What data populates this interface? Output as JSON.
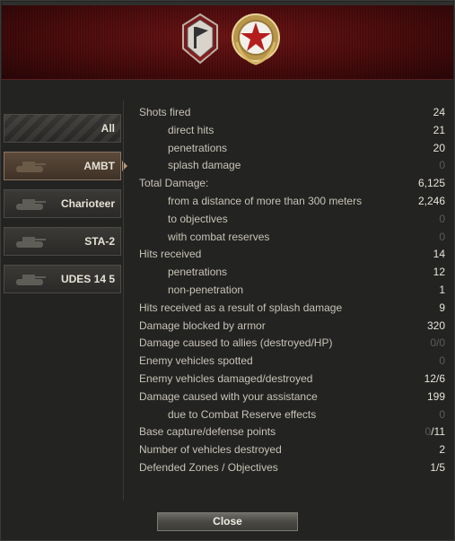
{
  "header": {
    "badges": [
      "shield-flag-badge-icon",
      "star-wreath-badge-icon"
    ],
    "accent_color": "#5a0f10"
  },
  "sidebar": {
    "items": [
      {
        "label": "All",
        "icon": "camo-pattern",
        "active": false
      },
      {
        "label": "AMBT",
        "icon": "tank-icon",
        "active": true
      },
      {
        "label": "Charioteer",
        "icon": "tank-icon",
        "active": false
      },
      {
        "label": "STA-2",
        "icon": "tank-icon",
        "active": false
      },
      {
        "label": "UDES 14 5",
        "icon": "tank-icon",
        "active": false
      }
    ]
  },
  "stats": [
    {
      "label": "Shots fired",
      "value": "24",
      "sub": false
    },
    {
      "label": "direct hits",
      "value": "21",
      "sub": true
    },
    {
      "label": "penetrations",
      "value": "20",
      "sub": true
    },
    {
      "label": "splash damage",
      "value": "0",
      "sub": true,
      "dim": true
    },
    {
      "label": "Total Damage:",
      "value": "6,125",
      "sub": false
    },
    {
      "label": "from a distance of more than 300 meters",
      "value": "2,246",
      "sub": true
    },
    {
      "label": "to objectives",
      "value": "0",
      "sub": true,
      "dim": true
    },
    {
      "label": "with combat reserves",
      "value": "0",
      "sub": true,
      "dim": true
    },
    {
      "label": "Hits received",
      "value": "14",
      "sub": false
    },
    {
      "label": "penetrations",
      "value": "12",
      "sub": true
    },
    {
      "label": "non-penetration",
      "value": "1",
      "sub": true
    },
    {
      "label": "Hits received as a result of splash damage",
      "value": "9",
      "sub": false
    },
    {
      "label": "Damage blocked by armor",
      "value": "320",
      "sub": false
    },
    {
      "label": "Damage caused to allies (destroyed/HP)",
      "value": "0/0",
      "sub": false,
      "dim": true
    },
    {
      "label": "Enemy vehicles spotted",
      "value": "0",
      "sub": false,
      "dim": true
    },
    {
      "label": "Enemy vehicles damaged/destroyed",
      "value": "12/6",
      "sub": false
    },
    {
      "label": "Damage caused with your assistance",
      "value": "199",
      "sub": false
    },
    {
      "label": "due to Combat Reserve effects",
      "value": "0",
      "sub": true,
      "dim": true
    },
    {
      "label": "Base capture/defense points",
      "value": "0/11",
      "sub": false,
      "partial_dim": true
    },
    {
      "label": "Number of vehicles destroyed",
      "value": "2",
      "sub": false
    },
    {
      "label": "Defended Zones / Objectives",
      "value": "1/5",
      "sub": false
    }
  ],
  "footer": {
    "close_label": "Close"
  }
}
